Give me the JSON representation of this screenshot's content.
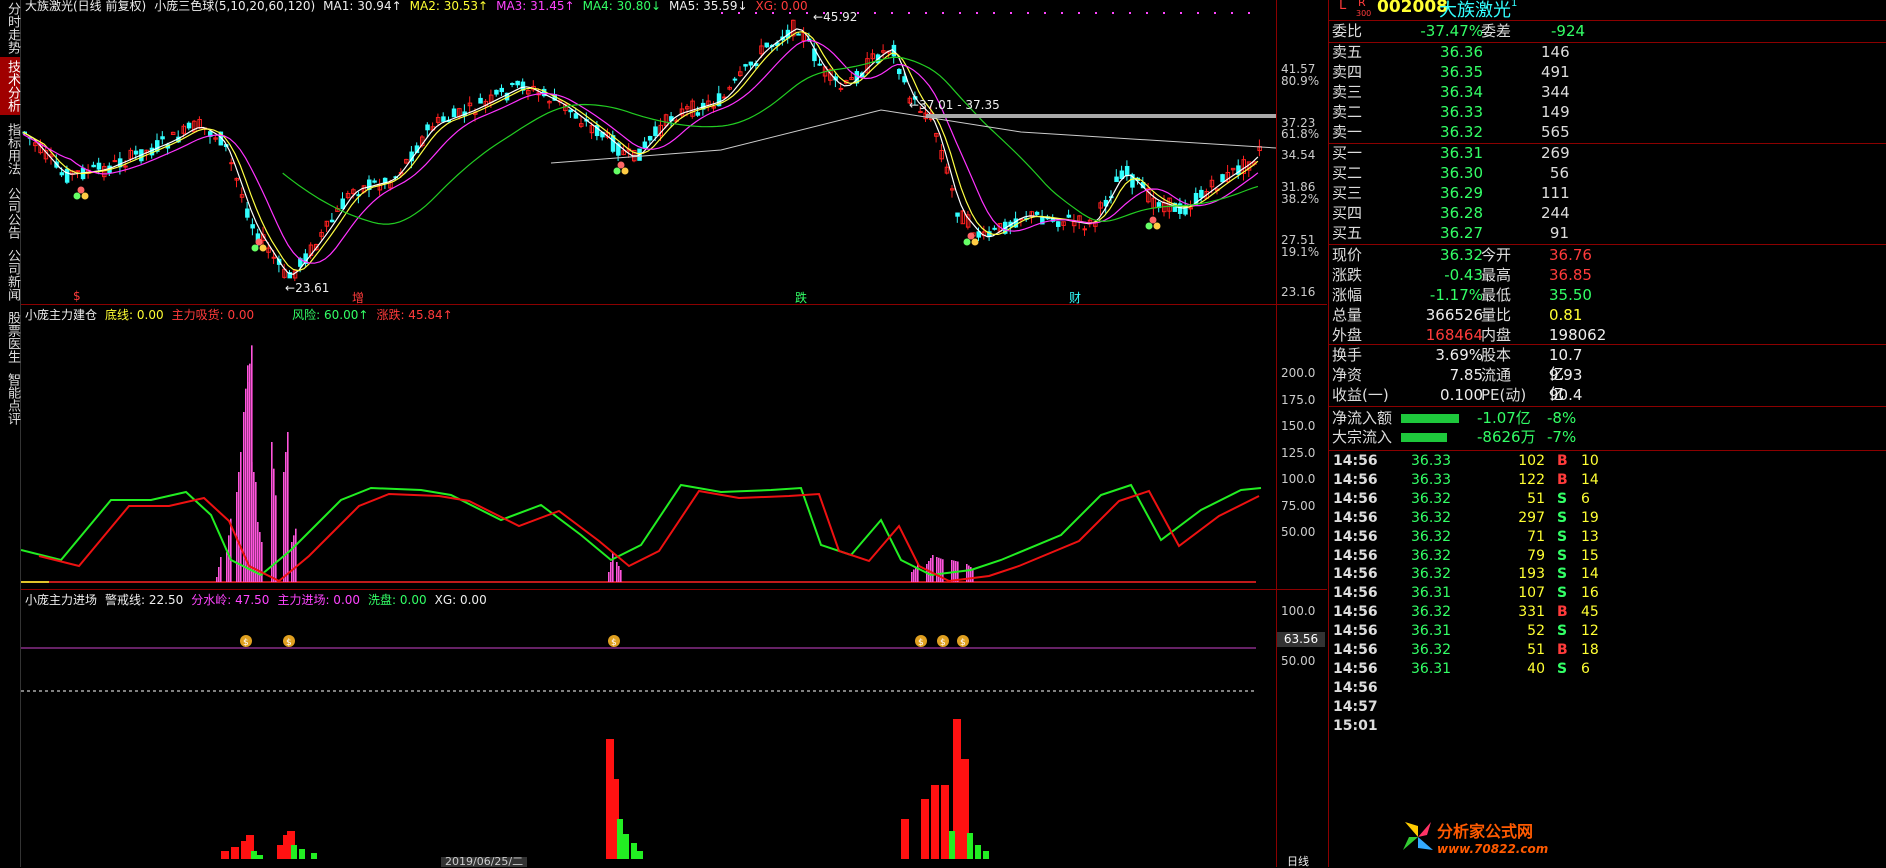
{
  "left_tabs": [
    {
      "label": "分时走势"
    },
    {
      "label": "技术分析"
    },
    {
      "label": "指标用法"
    },
    {
      "label": "公司公告"
    },
    {
      "label": "公司新闻"
    },
    {
      "label": "股票医生"
    },
    {
      "label": "智能点评"
    }
  ],
  "main_panel": {
    "title": "大族激光(日线 前复权)",
    "indicator": "小庞三色球(5,10,20,60,120)",
    "ma1": "MA1: 30.94↑",
    "ma2": "MA2: 30.53↑",
    "ma3": "MA3: 31.45↑",
    "ma4": "MA4: 30.80↓",
    "ma5": "MA5: 35.59↓",
    "xg": "XG: 0.00",
    "y_labels": [
      "41.57",
      "80.9%",
      "37.23",
      "61.8%",
      "34.54",
      "31.86",
      "38.2%",
      "27.51",
      "19.1%",
      "23.16"
    ],
    "high_label": "45.92",
    "low_label": "23.61",
    "range_label": "37.01 - 37.35",
    "markers": [
      "$",
      "增",
      "跌",
      "财"
    ],
    "colors": {
      "up": "#ff2020",
      "down": "#33ffff",
      "ma_yellow": "#ffff44",
      "ma_white": "#ffffff",
      "ma_magenta": "#ff33ff",
      "ma_green": "#22cc22"
    }
  },
  "panel2": {
    "title": "小庞主力建仓",
    "fields": [
      "底线: 0.00",
      "主力吸货: 0.00",
      "风险: 60.00↑",
      "涨跌: 45.84↑"
    ],
    "y_labels": [
      "200.0",
      "175.0",
      "150.0",
      "125.0",
      "100.0",
      "75.00",
      "50.00"
    ]
  },
  "panel3": {
    "title": "小庞主力进场",
    "fields": [
      "警戒线: 22.50",
      "分水岭: 47.50",
      "主力进场: 0.00",
      "洗盘: 0.00",
      "XG: 0.00"
    ],
    "y_labels": [
      "100.0",
      "50.00"
    ],
    "current_value": "63.56",
    "bottom_labels": [
      "2019/06/25/二",
      "日线"
    ]
  },
  "quote": {
    "flags": {
      "l": "L",
      "r": "R",
      "r_sub": "300"
    },
    "code": "002008",
    "name": "大族激光",
    "weibi": {
      "label": "委比",
      "value": "-37.47%",
      "label2": "委差",
      "value2": "-924"
    },
    "sell": [
      {
        "label": "卖五",
        "price": "36.36",
        "vol": "146"
      },
      {
        "label": "卖四",
        "price": "36.35",
        "vol": "491"
      },
      {
        "label": "卖三",
        "price": "36.34",
        "vol": "344"
      },
      {
        "label": "卖二",
        "price": "36.33",
        "vol": "149"
      },
      {
        "label": "卖一",
        "price": "36.32",
        "vol": "565"
      }
    ],
    "buy": [
      {
        "label": "买一",
        "price": "36.31",
        "vol": "269"
      },
      {
        "label": "买二",
        "price": "36.30",
        "vol": "56"
      },
      {
        "label": "买三",
        "price": "36.29",
        "vol": "111"
      },
      {
        "label": "买四",
        "price": "36.28",
        "vol": "244"
      },
      {
        "label": "买五",
        "price": "36.27",
        "vol": "91"
      }
    ],
    "stats": [
      {
        "l1": "现价",
        "v1": "36.32",
        "c1": "green",
        "l2": "今开",
        "v2": "36.76",
        "c2": "red"
      },
      {
        "l1": "涨跌",
        "v1": "-0.43",
        "c1": "green",
        "l2": "最高",
        "v2": "36.85",
        "c2": "red"
      },
      {
        "l1": "涨幅",
        "v1": "-1.17%",
        "c1": "green",
        "l2": "最低",
        "v2": "35.50",
        "c2": "green"
      },
      {
        "l1": "总量",
        "v1": "366526",
        "c1": "white",
        "l2": "量比",
        "v2": "0.81",
        "c2": "yellow"
      },
      {
        "l1": "外盘",
        "v1": "168464",
        "c1": "red",
        "l2": "内盘",
        "v2": "198062",
        "c2": "white"
      },
      {
        "l1": "换手",
        "v1": "3.69%",
        "c1": "white",
        "l2": "股本",
        "v2": "10.7亿",
        "c2": "white"
      },
      {
        "l1": "净资",
        "v1": "7.85",
        "c1": "white",
        "l2": "流通",
        "v2": "9.93亿",
        "c2": "white"
      },
      {
        "l1": "收益(一)",
        "v1": "0.100",
        "c1": "white",
        "l2": "PE(动)",
        "v2": "90.4",
        "c2": "white"
      }
    ],
    "flow": [
      {
        "label": "净流入额",
        "value": "-1.07亿",
        "pct": "-8%"
      },
      {
        "label": "大宗流入",
        "value": "-8626万",
        "pct": "-7%"
      }
    ],
    "ticks": [
      {
        "t": "14:56",
        "p": "36.33",
        "c": "green",
        "v": "102",
        "bs": "B",
        "x": "10"
      },
      {
        "t": "14:56",
        "p": "36.33",
        "c": "green",
        "v": "122",
        "bs": "B",
        "x": "14"
      },
      {
        "t": "14:56",
        "p": "36.32",
        "c": "green",
        "v": "51",
        "bs": "S",
        "x": "6"
      },
      {
        "t": "14:56",
        "p": "36.32",
        "c": "green",
        "v": "297",
        "bs": "S",
        "x": "19"
      },
      {
        "t": "14:56",
        "p": "36.32",
        "c": "green",
        "v": "71",
        "bs": "S",
        "x": "13"
      },
      {
        "t": "14:56",
        "p": "36.32",
        "c": "green",
        "v": "79",
        "bs": "S",
        "x": "15"
      },
      {
        "t": "14:56",
        "p": "36.32",
        "c": "green",
        "v": "193",
        "bs": "S",
        "x": "14"
      },
      {
        "t": "14:56",
        "p": "36.31",
        "c": "green",
        "v": "107",
        "bs": "S",
        "x": "16"
      },
      {
        "t": "14:56",
        "p": "36.32",
        "c": "green",
        "v": "331",
        "bs": "B",
        "x": "45"
      },
      {
        "t": "14:56",
        "p": "36.31",
        "c": "green",
        "v": "52",
        "bs": "S",
        "x": "12"
      },
      {
        "t": "14:56",
        "p": "36.32",
        "c": "green",
        "v": "51",
        "bs": "B",
        "x": "18"
      },
      {
        "t": "14:56",
        "p": "36.31",
        "c": "green",
        "v": "40",
        "bs": "S",
        "x": "6"
      },
      {
        "t": "14:56",
        "p": "",
        "c": "green",
        "v": "",
        "bs": "",
        "x": ""
      },
      {
        "t": "14:57",
        "p": "",
        "c": "green",
        "v": "",
        "bs": "",
        "x": ""
      },
      {
        "t": "15:01",
        "p": "",
        "c": "green",
        "v": "",
        "bs": "",
        "x": ""
      }
    ],
    "watermark": {
      "title": "分析家公式网",
      "url": "www.70822.com"
    }
  }
}
